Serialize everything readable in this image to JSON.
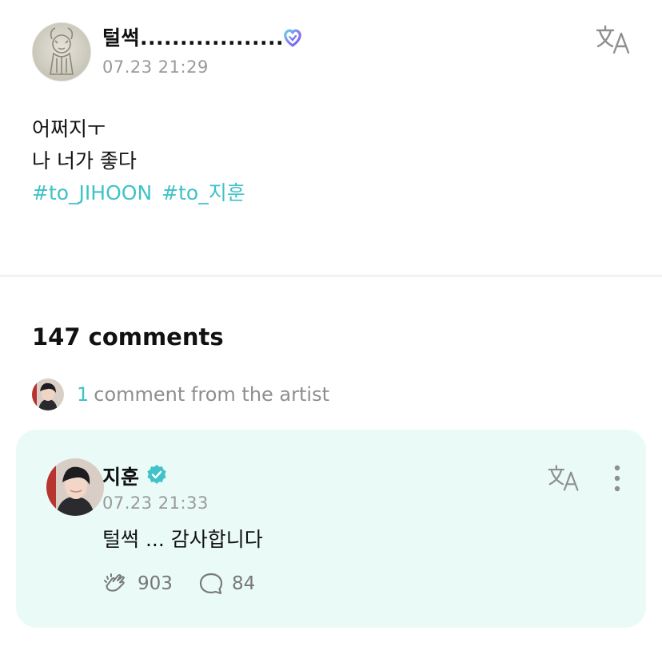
{
  "post": {
    "author_name": "털썩..................",
    "timestamp": "07.23 21:29",
    "lines": [
      "어쩌지ㅜ",
      "나 너가 좋다"
    ],
    "hashtags": [
      "#to_JIHOON",
      "#to_지훈"
    ]
  },
  "comments": {
    "count_label": "147 comments",
    "artist_count": "1",
    "artist_label": "comment from the artist"
  },
  "artist_comment": {
    "name": "지훈",
    "timestamp": "07.23 21:33",
    "text": "털썩 ... 감사합니다",
    "likes": "903",
    "replies": "84"
  },
  "icons": {
    "translate": "translate-icon",
    "heart_badge": "membership-heart-icon",
    "verified": "verified-badge-icon",
    "more": "more-vertical-icon",
    "like": "clap-hand-icon",
    "reply": "speech-bubble-icon"
  },
  "colors": {
    "accent": "#3fc2c8",
    "card_background": "#e9faf7",
    "muted_text": "#9a9a9a"
  }
}
